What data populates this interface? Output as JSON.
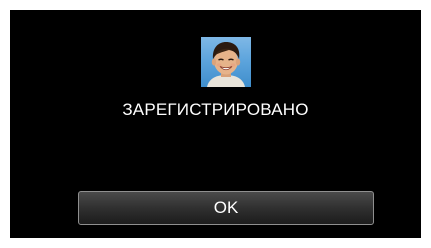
{
  "dialog": {
    "thumbnail_icon": "registered-face-photo",
    "message": "ЗАРЕГИСТРИРОВАНО",
    "ok_label": "OK"
  },
  "colors": {
    "background": "#000000",
    "text": "#ffffff",
    "button_border": "#8f8f8f"
  }
}
